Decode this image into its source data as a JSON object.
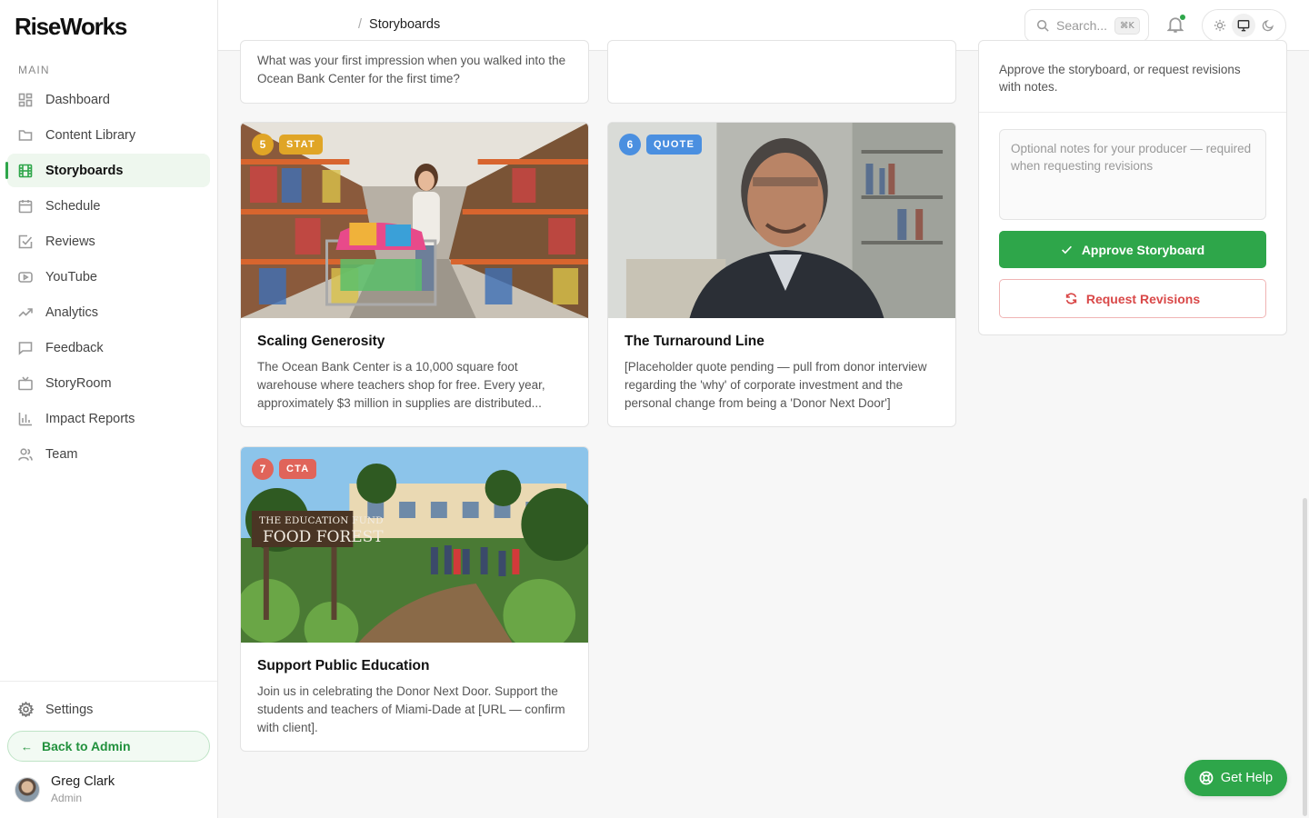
{
  "app": {
    "logo": "RiseWorks"
  },
  "sidebar": {
    "section_label": "MAIN",
    "items": [
      {
        "label": "Dashboard",
        "icon": "grid-icon"
      },
      {
        "label": "Content Library",
        "icon": "folder-icon"
      },
      {
        "label": "Storyboards",
        "icon": "film-icon",
        "active": true
      },
      {
        "label": "Schedule",
        "icon": "calendar-icon"
      },
      {
        "label": "Reviews",
        "icon": "check-square-icon"
      },
      {
        "label": "YouTube",
        "icon": "youtube-icon"
      },
      {
        "label": "Analytics",
        "icon": "trend-icon"
      },
      {
        "label": "Feedback",
        "icon": "message-icon"
      },
      {
        "label": "StoryRoom",
        "icon": "tv-icon"
      },
      {
        "label": "Impact Reports",
        "icon": "bar-chart-icon"
      },
      {
        "label": "Team",
        "icon": "users-icon"
      }
    ],
    "settings_label": "Settings",
    "back_label": "Back to Admin",
    "user": {
      "name": "Greg Clark",
      "role": "Admin"
    }
  },
  "header": {
    "breadcrumb_sep": "/",
    "breadcrumb": "Storyboards",
    "search_placeholder": "Search...",
    "search_kbd": "⌘K"
  },
  "cards_partial": {
    "left_text": "What was your first impression when you walked into the Ocean Bank Center for the first time?"
  },
  "cards": [
    {
      "num": "5",
      "type": "STAT",
      "title": "Scaling Generosity",
      "text": "The Ocean Bank Center is a 10,000 square foot warehouse where teachers shop for free. Every year, approximately $3 million in supplies are distributed...",
      "num_color": "#e0a526",
      "type_color": "#e0a526"
    },
    {
      "num": "6",
      "type": "QUOTE",
      "title": "The Turnaround Line",
      "text": "[Placeholder quote pending — pull from donor interview regarding the 'why' of corporate investment and the personal change from being a 'Donor Next Door']",
      "num_color": "#4a8fe0",
      "type_color": "#4a8fe0"
    },
    {
      "num": "7",
      "type": "CTA",
      "title": "Support Public Education",
      "text": "Join us in celebrating the Donor Next Door. Support the students and teachers of Miami-Dade at [URL — confirm with client].",
      "num_color": "#e0645a",
      "type_color": "#e0645a"
    }
  ],
  "image_signs": {
    "line1": "THE EDUCATION FUND",
    "line2": "FOOD FOREST"
  },
  "panel": {
    "description": "Approve the storyboard, or request revisions with notes.",
    "notes_placeholder": "Optional notes for your producer — required when requesting revisions",
    "approve_label": "Approve Storyboard",
    "revise_label": "Request Revisions"
  },
  "help_label": "Get Help",
  "colors": {
    "accent": "#2ea64a",
    "danger": "#d94848"
  }
}
